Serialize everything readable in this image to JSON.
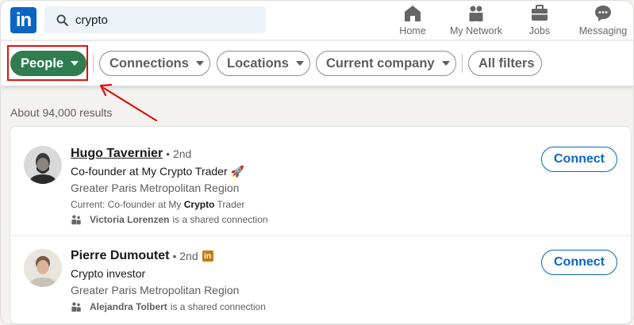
{
  "nav": {
    "logo": "in",
    "search_value": "crypto",
    "items": [
      {
        "label": "Home",
        "icon": "home-icon"
      },
      {
        "label": "My Network",
        "icon": "network-icon"
      },
      {
        "label": "Jobs",
        "icon": "briefcase-icon"
      },
      {
        "label": "Messaging",
        "icon": "message-icon"
      }
    ]
  },
  "filters": [
    {
      "label": "People",
      "active": true
    },
    {
      "label": "Connections",
      "active": false
    },
    {
      "label": "Locations",
      "active": false
    },
    {
      "label": "Current company",
      "active": false
    },
    {
      "label": "All filters",
      "active": false
    }
  ],
  "results_count": "About 94,000 results",
  "results": [
    {
      "name": "Hugo Tavernier",
      "degree": "• 2nd",
      "headline": "Co-founder at My Crypto Trader 🚀",
      "location": "Greater Paris Metropolitan Region",
      "current_prefix": "Current: Co-founder at My ",
      "current_bold": "Crypto",
      "current_suffix": " Trader",
      "shared_name": "Victoria Lorenzen",
      "shared_text": "is a shared connection",
      "action": "Connect"
    },
    {
      "name": "Pierre Dumoutet",
      "degree": "• 2nd",
      "headline": "Crypto investor",
      "location": "Greater Paris Metropolitan Region",
      "shared_name": "Alejandra Tolbert",
      "shared_text": "is a shared connection",
      "action": "Connect"
    }
  ],
  "colors": {
    "brand": "#0a66c2",
    "active_filter": "#2f7d4f",
    "annotation_red": "#e01010"
  }
}
